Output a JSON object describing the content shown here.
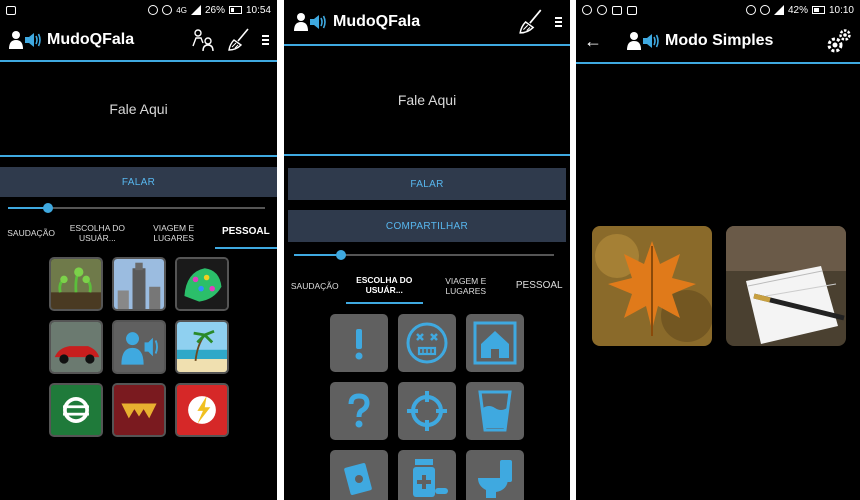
{
  "screen1": {
    "status": {
      "time": "10:54",
      "network": "4G",
      "battery": "26%"
    },
    "app_title": "MudoQFala",
    "speak_placeholder": "Fale Aqui",
    "speak_button": "FALAR",
    "tabs": [
      "SAUDAÇÃO",
      "ESCOLHA DO USUÁR...",
      "VIAGEM E LUGARES",
      "PESSOAL"
    ],
    "active_tab": "PESSOAL",
    "grid_icons": [
      "plants-photo",
      "tower-photo",
      "leopard-art",
      "red-car-photo",
      "app-logo-icon",
      "beach-photo",
      "green-lantern-icon",
      "wonder-woman-icon",
      "flash-icon"
    ]
  },
  "screen2": {
    "app_title": "MudoQFala",
    "speak_placeholder": "Fale Aqui",
    "speak_button": "FALAR",
    "share_button": "COMPARTILHAR",
    "tabs": [
      "SAUDAÇÃO",
      "ESCOLHA DO USUÁR...",
      "VIAGEM E LUGARES",
      "PESSOAL"
    ],
    "active_tab": "ESCOLHA DO USUÁR...",
    "grid_icons": [
      "exclamation-icon",
      "sick-face-icon",
      "house-icon",
      "question-icon",
      "target-icon",
      "water-glass-icon",
      "money-icon",
      "medicine-icon",
      "toilet-icon"
    ]
  },
  "screen3": {
    "status": {
      "time": "10:10",
      "battery": "42%"
    },
    "title": "Modo Simples",
    "cards": [
      "autumn-leaf-photo",
      "notebook-pen-photo"
    ]
  },
  "colors": {
    "accent": "#3fa9e0",
    "button_bg": "#2f3a4c",
    "tile_gray": "#606060"
  }
}
